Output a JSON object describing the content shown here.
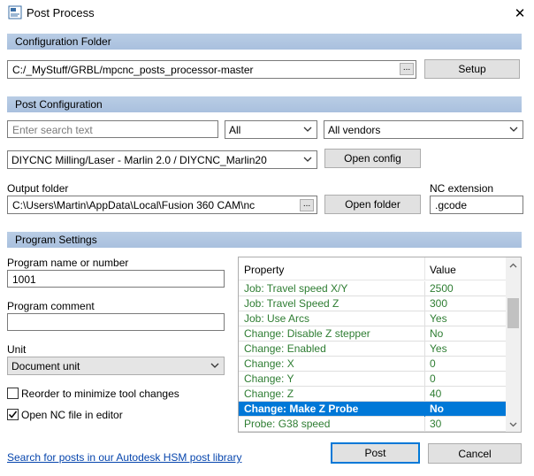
{
  "window": {
    "title": "Post Process",
    "close": "✕"
  },
  "config_folder": {
    "header": "Configuration Folder",
    "path": "C:/_MyStuff/GRBL/mpcnc_posts_processor-master",
    "browse": "...",
    "setup_label": "Setup"
  },
  "post_config": {
    "header": "Post Configuration",
    "search_placeholder": "Enter search text",
    "filter_type": "All",
    "vendor": "All vendors",
    "post": "DIYCNC Milling/Laser - Marlin 2.0 / DIYCNC_Marlin20",
    "open_config_label": "Open config",
    "output_label": "Output folder",
    "output_path": "C:\\Users\\Martin\\AppData\\Local\\Fusion 360 CAM\\nc",
    "output_browse": "...",
    "open_folder_label": "Open folder",
    "extension_label": "NC extension",
    "extension": ".gcode"
  },
  "program": {
    "header": "Program Settings",
    "name_label": "Program name or number",
    "name_value": "1001",
    "comment_label": "Program comment",
    "comment_value": "",
    "unit_label": "Unit",
    "unit_value": "Document unit",
    "reorder_label": "Reorder to minimize tool changes",
    "reorder_checked": false,
    "open_nc_label": "Open NC file in editor",
    "open_nc_checked": true
  },
  "properties": {
    "col_property": "Property",
    "col_value": "Value",
    "rows": [
      {
        "name": "Job: Travel speed X/Y",
        "value": "2500"
      },
      {
        "name": "Job: Travel Speed Z",
        "value": "300"
      },
      {
        "name": "Job: Use Arcs",
        "value": "Yes"
      },
      {
        "name": "Change: Disable Z stepper",
        "value": "No"
      },
      {
        "name": "Change: Enabled",
        "value": "Yes"
      },
      {
        "name": "Change: X",
        "value": "0"
      },
      {
        "name": "Change: Y",
        "value": "0"
      },
      {
        "name": "Change: Z",
        "value": "40"
      },
      {
        "name": "Change: Make Z Probe",
        "value": "No"
      },
      {
        "name": "Probe: G38 speed",
        "value": "30"
      }
    ],
    "selected_index": 8
  },
  "footer": {
    "link": "Search for posts in our Autodesk HSM post library",
    "post_label": "Post",
    "cancel_label": "Cancel"
  },
  "colors": {
    "accent": "#0078d7",
    "section_bg": "#b9cde5",
    "property_text": "#2e7d32"
  }
}
